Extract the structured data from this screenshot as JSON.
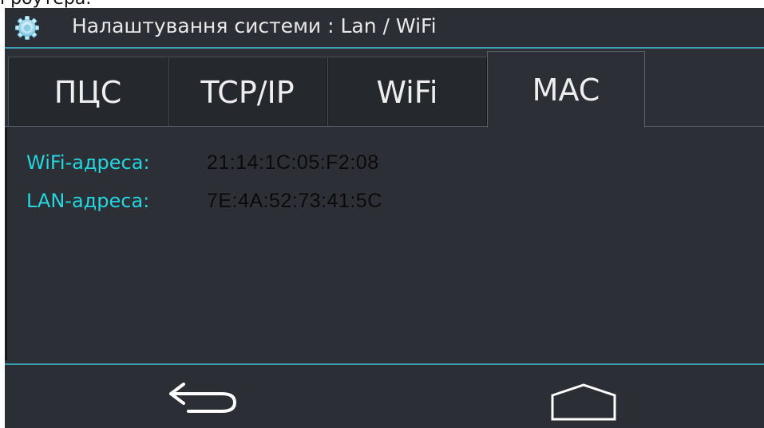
{
  "cropped_text": "і роутера.",
  "window": {
    "title": "Налаштування системи : Lan / WiFi",
    "icon": "gear-icon"
  },
  "tabs": [
    {
      "label": "ПЦС",
      "active": false
    },
    {
      "label": "TCP/IP",
      "active": false
    },
    {
      "label": "WiFi",
      "active": false
    },
    {
      "label": "MAC",
      "active": true
    }
  ],
  "mac": {
    "wifi_label": "WiFi-адреса:",
    "wifi_value": "21:14:1C:05:F2:08",
    "lan_label": "LAN-адреса:",
    "lan_value": "7E:4A:52:73:41:5C"
  },
  "navbar": {
    "back_icon": "back-arrow-icon",
    "home_icon": "home-icon"
  },
  "colors": {
    "accent": "#3e9fb4",
    "label": "#24d6dd",
    "background": "#2c3036"
  }
}
